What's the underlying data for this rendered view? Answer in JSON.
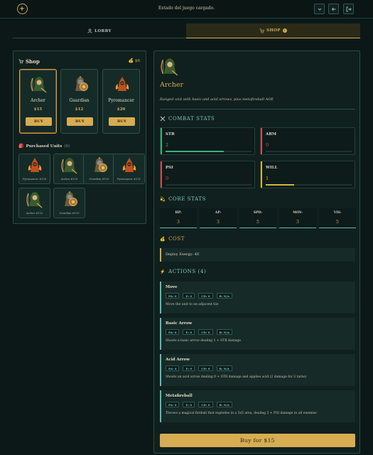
{
  "header": {
    "status_text": "Estado del juego cargado.",
    "icons": [
      "compass-logo-icon",
      "chevron-down-icon",
      "arrow-left-icon",
      "logout-icon"
    ]
  },
  "tabs": [
    {
      "label": "LOBBY",
      "icon": "user-icon",
      "active": false
    },
    {
      "label": "SHOP",
      "icon": "cart-icon",
      "active": true,
      "badge": "!"
    }
  ],
  "shop": {
    "title": "Shop",
    "gold": "$6",
    "cards": [
      {
        "name": "Archer",
        "price": "$15",
        "buy_label": "BUY",
        "portrait": "archer",
        "selected": true
      },
      {
        "name": "Guardian",
        "price": "$12",
        "buy_label": "BUY",
        "portrait": "guardian",
        "selected": false
      },
      {
        "name": "Pyromancer",
        "price": "$20",
        "buy_label": "BUY",
        "portrait": "pyromancer",
        "selected": false
      }
    ],
    "purchased_title": "Purchased Units",
    "purchased_count": "(6)",
    "purchased": [
      {
        "label": "Pyromancer #128",
        "portrait": "pyromancer"
      },
      {
        "label": "Archer #129",
        "portrait": "archer"
      },
      {
        "label": "Guardian #130",
        "portrait": "guardian"
      },
      {
        "label": "Pyromancer #131",
        "portrait": "pyromancer"
      },
      {
        "label": "Archer #132",
        "portrait": "archer"
      },
      {
        "label": "Guardian #133",
        "portrait": "guardian"
      }
    ]
  },
  "detail": {
    "name": "Archer",
    "description": "Ranged unit with basic and acid arrows, plus metafireball AOE",
    "combat_title": "COMBAT STATS",
    "combat_stats": [
      {
        "label": "STR",
        "value": "2",
        "bar_fraction": 0.68,
        "color": "#3bb37a"
      },
      {
        "label": "ARM",
        "value": "0",
        "bar_fraction": 0,
        "color": "#d04c4c"
      },
      {
        "label": "PSI",
        "value": "0",
        "bar_fraction": 0,
        "color": "#d04c4c"
      },
      {
        "label": "WILL",
        "value": "1",
        "bar_fraction": 0.33,
        "color": "#d4b53a"
      }
    ],
    "core_title": "CORE STATS",
    "core_stats": [
      {
        "label": "HP:",
        "value": "3"
      },
      {
        "label": "AP:",
        "value": "3"
      },
      {
        "label": "SPD:",
        "value": "5"
      },
      {
        "label": "MOV:",
        "value": "3"
      },
      {
        "label": "VIS:",
        "value": "5"
      }
    ],
    "cost_title": "COST",
    "cost_text": "Deploy Energy: 4E",
    "actions_title": "ACTIONS (4)",
    "actions": [
      {
        "name": "Move",
        "tags": [
          "PA: 0",
          "E: 0",
          "CD: 0",
          "R: N/A"
        ],
        "desc": "Move the unit to an adjacent tile"
      },
      {
        "name": "Basic Arrow",
        "tags": [
          "PA: 0",
          "E: 0",
          "CD: 0",
          "R: N/A"
        ],
        "desc": "Shoots a basic arrow dealing 1 + STR damage"
      },
      {
        "name": "Acid Arrow",
        "tags": [
          "PA: 0",
          "E: 0",
          "CD: 0",
          "R: N/A"
        ],
        "desc": "Shoots an acid arrow dealing 0 + STR damage and applies acid (2 damage for 3 turns)"
      },
      {
        "name": "Metafireball",
        "tags": [
          "PA: 0",
          "E: 0",
          "CD: 0",
          "R: N/A"
        ],
        "desc": "Throws a magical fireball that explodes in a 5x5 area, dealing 3 + PSI damage to all enemies"
      }
    ],
    "buy_button": "Buy for $15"
  },
  "colors": {
    "accent_gold": "#d4aa52",
    "accent_teal": "#78c9c3",
    "background": "#0b1817"
  }
}
